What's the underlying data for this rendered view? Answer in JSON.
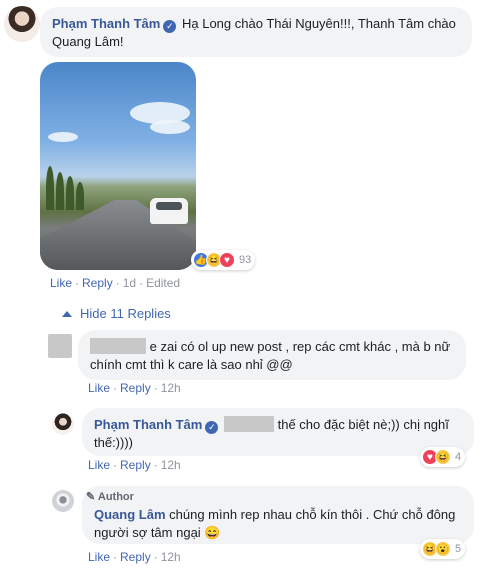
{
  "main_comment": {
    "author": "Phạm Thanh Tâm",
    "text": "Hạ Long chào Thái Nguyên!!!, Thanh Tâm chào Quang Lâm!",
    "reaction_count": "93",
    "like": "Like",
    "reply": "Reply",
    "time": "1d",
    "edited": "Edited"
  },
  "hide_replies": "Hide 11 Replies",
  "replies": [
    {
      "text": "e zai có ol up new post , rep các cmt khác , mà b nữ chính cmt thì k care là sao nhỉ @@",
      "like": "Like",
      "reply": "Reply",
      "time": "12h"
    },
    {
      "author": "Phạm Thanh Tâm",
      "text": "thế cho đặc biệt nè;)) chị nghĩ thế:))))",
      "like": "Like",
      "reply": "Reply",
      "time": "12h",
      "reaction_count": "4"
    },
    {
      "badge": "Author",
      "author": "Quang Lâm",
      "text": "chúng mình rep nhau chỗ kín thôi . Chứ chỗ đông người sợ tâm ngại 😄",
      "like": "Like",
      "reply": "Reply",
      "time": "12h",
      "reaction_count": "5"
    }
  ]
}
